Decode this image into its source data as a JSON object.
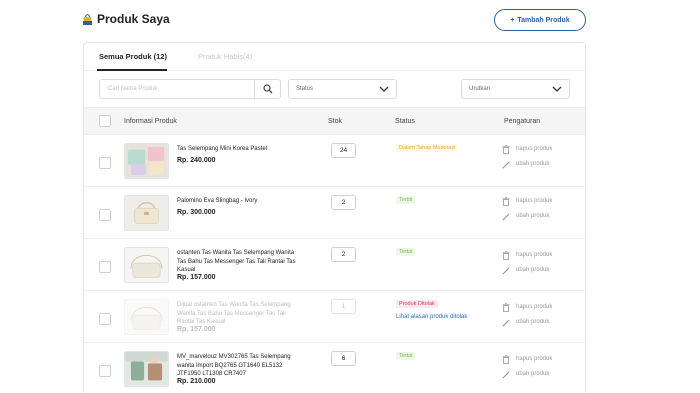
{
  "header": {
    "title": "Produk Saya",
    "add_button": "Tambah Produk",
    "add_button_icon": "+"
  },
  "tabs": [
    {
      "label": "Semua Produk (12)",
      "active": true
    },
    {
      "label": "Produk Habis(4)",
      "active": false
    }
  ],
  "filters": {
    "search_placeholder": "Cari Nama Produk",
    "status_label": "Status",
    "sort_label": "Urutkan"
  },
  "table": {
    "columns": {
      "info": "Informasi Produk",
      "stock": "Stok",
      "status": "Status",
      "actions": "Pengaturan"
    },
    "delete_label": "hapus produk",
    "edit_label": "ubah produk",
    "rows": [
      {
        "name": "Tas Selempang Mini Korea Pastel",
        "price": "Rp. 240.000",
        "stock": "24",
        "status": "Dalam Tahap Moderasi",
        "status_type": "moderation",
        "reason_link": ""
      },
      {
        "name": "Palomino Eva Slingbag - Ivory",
        "price": "Rp. 300.000",
        "stock": "2",
        "status": "Terbit",
        "status_type": "published",
        "reason_link": ""
      },
      {
        "name": "ostanten Tas Wanita Tas Selempang Wanita Tas Bahu Tas Messenger Tas Tali Rantai Tas Kasual",
        "price": "Rp. 157.000",
        "stock": "2",
        "status": "Terbit",
        "status_type": "published",
        "reason_link": ""
      },
      {
        "name": "Dijual ostanten Tas Wanita Tas Selempang Wanita Tas Bahu Tas Messenger Tas Tali Rantai Tas Kasual",
        "price": "Rp. 157.000",
        "stock": "1",
        "status": "Produk Ditolak",
        "status_type": "rejected",
        "reason_link": "Lihat alasan produk ditolak"
      },
      {
        "name": "MV_marvelouz MV302765 Tas Selempang wanita Import BQ2765 GT1640 EL5132 JTF1950 LT1308 CR7407",
        "price": "Rp. 210.000",
        "stock": "6",
        "status": "Terbit",
        "status_type": "published",
        "reason_link": ""
      }
    ]
  },
  "colors": {
    "accent": "#2b5fa8",
    "moderation": "#f0a928",
    "published": "#86b85c",
    "rejected": "#d43a5a",
    "link": "#2b6cb0"
  },
  "icons": {
    "title": "shopping-bag-icon",
    "search": "search-icon",
    "dropdown": "chevron-down-icon",
    "delete": "trash-icon",
    "edit": "pencil-icon"
  }
}
